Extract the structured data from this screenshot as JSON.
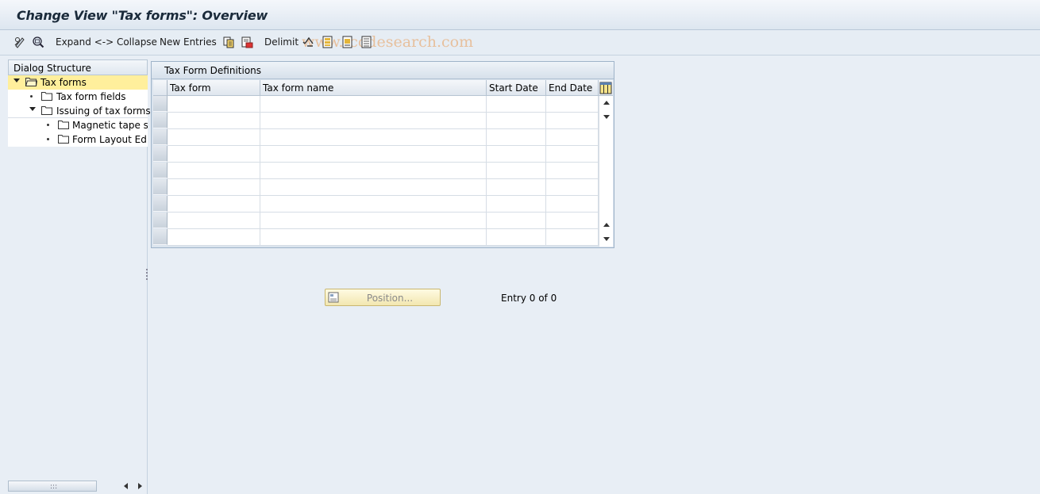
{
  "window": {
    "title": "Change View \"Tax forms\": Overview"
  },
  "toolbar": {
    "expand_collapse_label": "Expand <-> Collapse",
    "new_entries_label": "New Entries",
    "delimit_label": "Delimit",
    "watermark": "www.tcodesearch.com"
  },
  "dialog_structure": {
    "header": "Dialog Structure",
    "items": [
      {
        "label": "Tax forms",
        "level": 0,
        "expanded": true,
        "selected": true
      },
      {
        "label": "Tax form fields",
        "level": 1,
        "expanded": false,
        "selected": false
      },
      {
        "label": "Issuing of tax forms",
        "level": 1,
        "expanded": true,
        "selected": false
      },
      {
        "label": "Magnetic tape st",
        "level": 2,
        "expanded": false,
        "selected": false
      },
      {
        "label": "Form Layout Edit",
        "level": 2,
        "expanded": false,
        "selected": false
      }
    ]
  },
  "table": {
    "title": "Tax Form Definitions",
    "columns": [
      "Tax form",
      "Tax form name",
      "Start Date",
      "End Date"
    ],
    "rows": [],
    "visible_empty_rows": 9
  },
  "footer": {
    "position_button": "Position...",
    "entry_count": "Entry 0 of 0"
  },
  "colors": {
    "selected_tree_bg": "#ffef9c",
    "background": "#e8eef5",
    "watermark": "#e8b98f"
  }
}
